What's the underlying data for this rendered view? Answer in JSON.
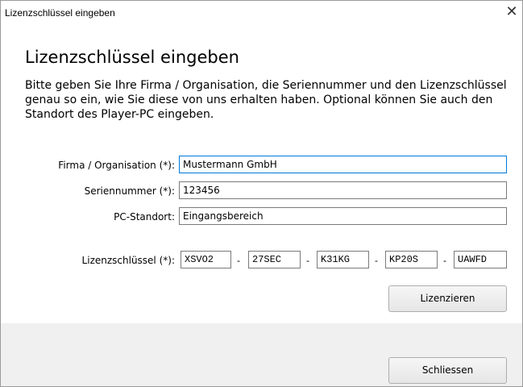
{
  "window": {
    "title": "Lizenzschlüssel eingeben",
    "close_glyph": "✕"
  },
  "main": {
    "heading": "Lizenzschlüssel eingeben",
    "intro": "Bitte geben Sie Ihre Firma / Organisation, die Seriennummer und den Lizenzschlüssel genau so ein, wie Sie diese von uns erhalten haben. Optional können Sie auch den Standort des Player-PC eingeben."
  },
  "form": {
    "company_label": "Firma / Organisation (*):",
    "company_value": "Mustermann GmbH",
    "serial_label": "Seriennummer (*):",
    "serial_value": "123456",
    "location_label": "PC-Standort:",
    "location_value": "Eingangsbereich",
    "license_label": "Lizenzschlüssel (*):",
    "license_parts": [
      "XSVO2",
      "27SEC",
      "K31KG",
      "KP20S",
      "UAWFD"
    ],
    "separator": "-"
  },
  "buttons": {
    "license": "Lizenzieren",
    "close": "Schliessen"
  }
}
